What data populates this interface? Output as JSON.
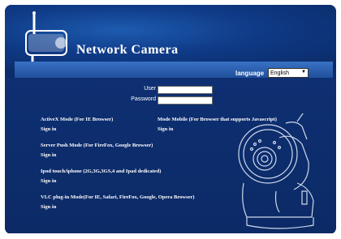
{
  "header": {
    "title": "Network  Camera"
  },
  "language": {
    "label": "language",
    "selected": "English"
  },
  "login": {
    "user_label": "User",
    "password_label": "Password",
    "user_value": "",
    "password_value": ""
  },
  "modes": [
    {
      "title": "ActiveX Mode (For IE Browser)",
      "action": "Sign in"
    },
    {
      "title": "Mode Mobile (For Browser that supports Javascript)",
      "action": "Sign in"
    },
    {
      "title": "Server Push Mode (For FireFox, Google Browser)",
      "action": "Sign in"
    },
    {
      "title": "Ipod touch/iphone (2G,3G,3GS,4 and Ipad dedicated)",
      "action": "Sign in"
    },
    {
      "title": "VLC plug-in Mode(For IE, Safari, FireFox, Google, Opera Browser)",
      "action": "Sign in"
    }
  ],
  "colors": {
    "background": "#0c2d6b",
    "banner": "#0f3a86",
    "bar": "#3a72c4",
    "text": "#ffffff"
  },
  "icons": [
    "camera-icon",
    "ptz-camera-icon",
    "dropdown-arrow-icon"
  ]
}
